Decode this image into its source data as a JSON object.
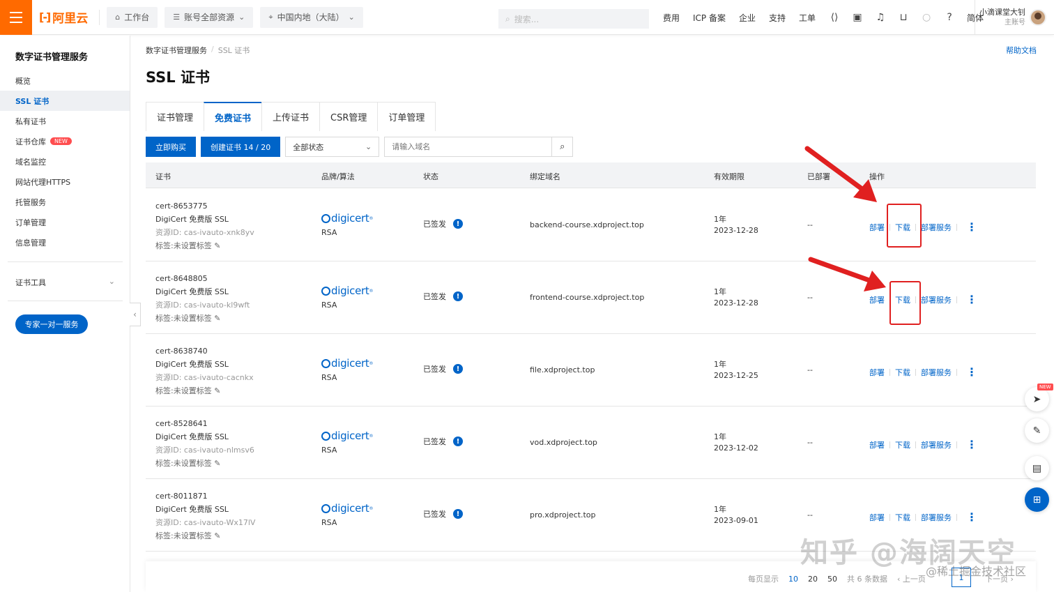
{
  "topbar": {
    "brand": "阿里云",
    "workbench": "工作台",
    "resources": "账号全部资源",
    "region": "中国内地（大陆）",
    "search_placeholder": "搜索...",
    "links": [
      "费用",
      "ICP 备案",
      "企业",
      "支持",
      "工单"
    ],
    "lang": "简体",
    "user_name": "小滴课堂大钊",
    "user_role": "主账号"
  },
  "sidebar": {
    "title": "数字证书管理服务",
    "items": [
      {
        "label": "概览"
      },
      {
        "label": "SSL 证书"
      },
      {
        "label": "私有证书"
      },
      {
        "label": "证书仓库",
        "badge": "NEW"
      },
      {
        "label": "域名监控"
      },
      {
        "label": "网站代理HTTPS"
      },
      {
        "label": "托管服务"
      },
      {
        "label": "订单管理"
      },
      {
        "label": "信息管理"
      }
    ],
    "tools": "证书工具",
    "expert_button": "专家一对一服务"
  },
  "breadcrumb": {
    "root": "数字证书管理服务",
    "current": "SSL 证书"
  },
  "help_link": "帮助文档",
  "page_title": "SSL 证书",
  "tabs": [
    "证书管理",
    "免费证书",
    "上传证书",
    "CSR管理",
    "订单管理"
  ],
  "toolbar": {
    "buy": "立即购买",
    "create": "创建证书 14 / 20",
    "status_select": "全部状态",
    "domain_placeholder": "请输入域名"
  },
  "table": {
    "headers": [
      "证书",
      "品牌/算法",
      "状态",
      "绑定域名",
      "有效期限",
      "已部署",
      "操作"
    ],
    "rows": [
      {
        "id": "cert-8653775",
        "name": "DigiCert 免费版 SSL",
        "resource": "资源ID: cas-ivauto-xnk8yv",
        "tag": "标签:未设置标签",
        "brand": "digicert",
        "algo": "RSA",
        "status": "已签发",
        "domain": "backend-course.xdproject.top",
        "period": "1年",
        "expire": "2023-12-28",
        "deployed": "--"
      },
      {
        "id": "cert-8648805",
        "name": "DigiCert 免费版 SSL",
        "resource": "资源ID: cas-ivauto-kl9wft",
        "tag": "标签:未设置标签",
        "brand": "digicert",
        "algo": "RSA",
        "status": "已签发",
        "domain": "frontend-course.xdproject.top",
        "period": "1年",
        "expire": "2023-12-28",
        "deployed": "--"
      },
      {
        "id": "cert-8638740",
        "name": "DigiCert 免费版 SSL",
        "resource": "资源ID: cas-ivauto-cacnkx",
        "tag": "标签:未设置标签",
        "brand": "digicert",
        "algo": "RSA",
        "status": "已签发",
        "domain": "file.xdproject.top",
        "period": "1年",
        "expire": "2023-12-25",
        "deployed": "--"
      },
      {
        "id": "cert-8528641",
        "name": "DigiCert 免费版 SSL",
        "resource": "资源ID: cas-ivauto-nlmsv6",
        "tag": "标签:未设置标签",
        "brand": "digicert",
        "algo": "RSA",
        "status": "已签发",
        "domain": "vod.xdproject.top",
        "period": "1年",
        "expire": "2023-12-02",
        "deployed": "--"
      },
      {
        "id": "cert-8011871",
        "name": "DigiCert 免费版 SSL",
        "resource": "资源ID: cas-ivauto-Wx17lV",
        "tag": "标签:未设置标签",
        "brand": "digicert",
        "algo": "RSA",
        "status": "已签发",
        "domain": "pro.xdproject.top",
        "period": "1年",
        "expire": "2023-09-01",
        "deployed": "--"
      }
    ],
    "ops": {
      "deploy": "部署",
      "download": "下载",
      "deploy_service": "部署服务"
    }
  },
  "pager": {
    "per_page_label": "每页显示",
    "sizes": [
      "10",
      "20",
      "50"
    ],
    "total": "共 6 条数据",
    "prev": "上一页",
    "page": "1",
    "next": "下一页"
  },
  "float": {
    "new_badge": "NEW"
  },
  "watermark": {
    "main": "知乎 @海阔天空",
    "sub": "@稀土掘金技术社区"
  },
  "colors": {
    "accent": "#0064c8",
    "brand": "#ff6a00",
    "annotation": "#e02020"
  }
}
